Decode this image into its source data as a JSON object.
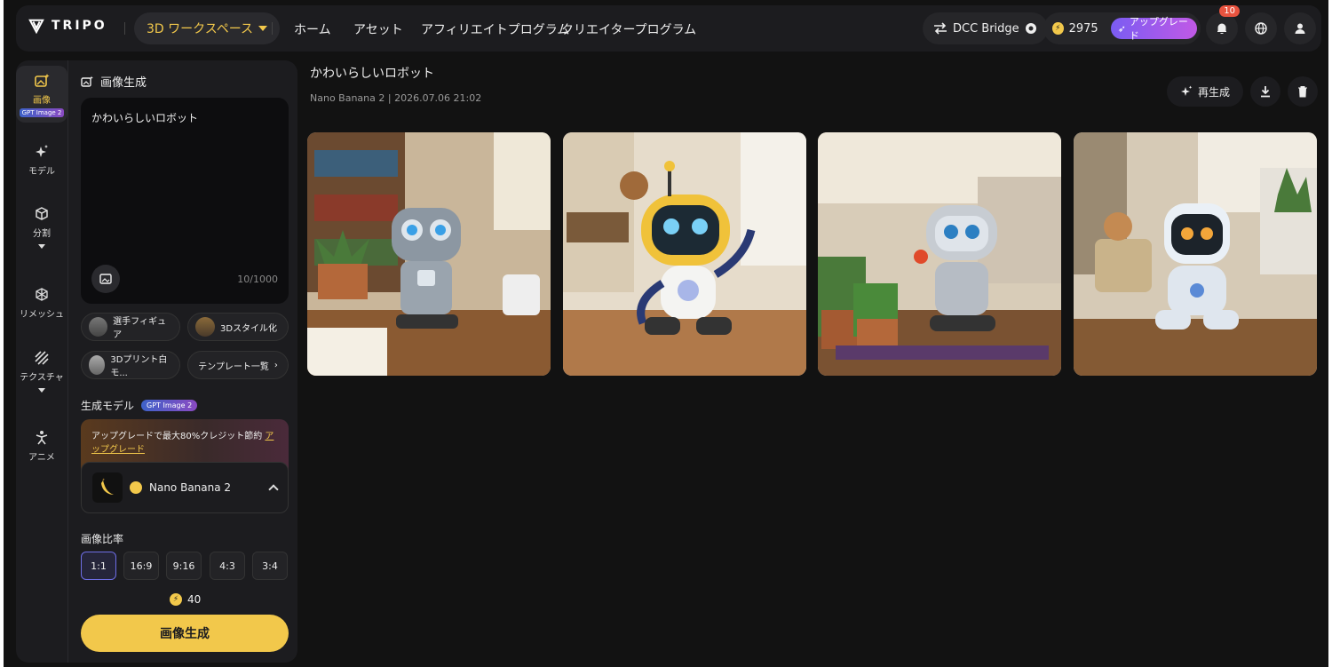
{
  "brand": {
    "name": "TRIPO"
  },
  "header": {
    "workspace_label": "3D ワークスペース",
    "nav": [
      "ホーム",
      "アセット",
      "アフィリエイトプログラム",
      "クリエイタープログラム"
    ],
    "dcc_bridge": "DCC Bridge",
    "credits": "2975",
    "upgrade": "アップグレード",
    "notifications": "10"
  },
  "rail": [
    {
      "label": "画像",
      "badge": "GPT Image 2",
      "icon": "image-sparkle-icon"
    },
    {
      "label": "モデル",
      "icon": "sparkle-icon"
    },
    {
      "label": "分割",
      "icon": "cube-icon"
    },
    {
      "label": "リメッシュ",
      "icon": "mesh-icon"
    },
    {
      "label": "テクスチャ",
      "icon": "texture-icon"
    },
    {
      "label": "アニメ",
      "icon": "figure-icon"
    }
  ],
  "panel": {
    "title": "画像生成",
    "prompt": "かわいらしいロボット",
    "prompt_count": "10/1000",
    "chips": [
      "選手フィギュア",
      "3Dスタイル化",
      "3Dプリント白モ...",
      "テンプレート一覧"
    ],
    "gen_model_label": "生成モデル",
    "gen_model_badge": "GPT Image 2",
    "upsell_text": "アップグレードで最大80%クレジット節約",
    "upsell_link": "アップグレード",
    "model_name": "Nano Banana 2",
    "ratio_label": "画像比率",
    "ratios": [
      "1:1",
      "16:9",
      "9:16",
      "4:3",
      "3:4"
    ],
    "selected_ratio": "1:1",
    "cost": "40",
    "generate_button": "画像生成"
  },
  "main": {
    "title": "かわいらしいロボット",
    "meta": "Nano Banana 2 | 2026.07.06 21:02",
    "regenerate": "再生成"
  },
  "colors": {
    "accent": "#f2c84b",
    "bg": "#121212",
    "surface": "#1c1c1f"
  }
}
